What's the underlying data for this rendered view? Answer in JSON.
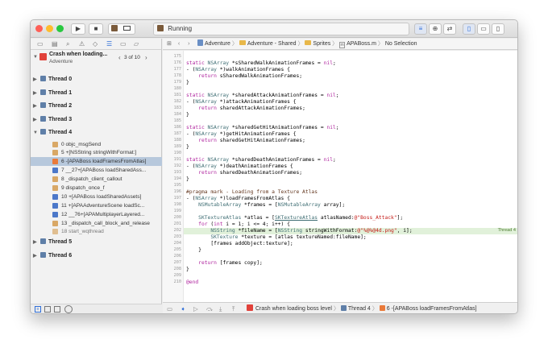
{
  "toolbar": {
    "status": "Running",
    "colors": {
      "close": "#fe5f57",
      "minimize": "#febc2e",
      "zoom": "#28c840"
    },
    "scheme_icon": "adventure-scheme-icon",
    "device_icon": "mac-device-icon"
  },
  "debug_nav": {
    "crash_title": "Crash when loading...",
    "crash_subtitle": "Adventure",
    "pager": "3 of 10",
    "threads": [
      {
        "label": "Thread 0"
      },
      {
        "label": "Thread 1"
      },
      {
        "label": "Thread 2"
      },
      {
        "label": "Thread 3"
      },
      {
        "label": "Thread 4"
      }
    ],
    "frames": [
      {
        "label": "0 objc_msgSend",
        "icon": "#d9a866"
      },
      {
        "label": "5 +[NSString stringWithFormat:]",
        "icon": "#d9a866"
      },
      {
        "label": "6 -[APABoss loadFramesFromAtlas]",
        "icon": "#e97a3a",
        "selected": true
      },
      {
        "label": "7 __27+[APABoss loadSharedAss...",
        "icon": "#4c78c9"
      },
      {
        "label": "8 _dispatch_client_callout",
        "icon": "#d9a866"
      },
      {
        "label": "9 dispatch_once_f",
        "icon": "#d9a866"
      },
      {
        "label": "10 +[APABoss loadSharedAssets]",
        "icon": "#4c78c9"
      },
      {
        "label": "11 +[APAAdventureScene loadSc...",
        "icon": "#4c78c9"
      },
      {
        "label": "12 __76+[APAMultiplayerLayered...",
        "icon": "#4c78c9"
      },
      {
        "label": "13 _dispatch_call_block_and_release",
        "icon": "#d9a866"
      },
      {
        "label": "18 start_wqthread",
        "icon": "#d9a866",
        "dim": true
      }
    ],
    "threads_after": [
      {
        "label": "Thread 5"
      },
      {
        "label": "Thread 6"
      }
    ]
  },
  "jump_bar": {
    "items": [
      "Adventure",
      "Adventure - Shared",
      "Sprites",
      "APABoss.m",
      "No Selection"
    ]
  },
  "code": {
    "line_numbers": [
      "174",
      "175",
      "176",
      "177",
      "178",
      "179",
      "180",
      "181",
      "182",
      "183",
      "184",
      "185",
      "186",
      "187",
      "188",
      "189",
      "190",
      "191",
      "192",
      "193",
      "194",
      "195",
      "196",
      "197",
      "198",
      "199",
      "200",
      "201",
      "202",
      "203",
      "204",
      "205",
      "206",
      "207",
      "208",
      "209",
      "210"
    ],
    "highlight_line_label": "Thread 4"
  },
  "debug_bar": {
    "crumbs": [
      "Crash when loading boss level",
      "Thread 4",
      "6 -[APABoss loadFramesFromAtlas]"
    ]
  }
}
